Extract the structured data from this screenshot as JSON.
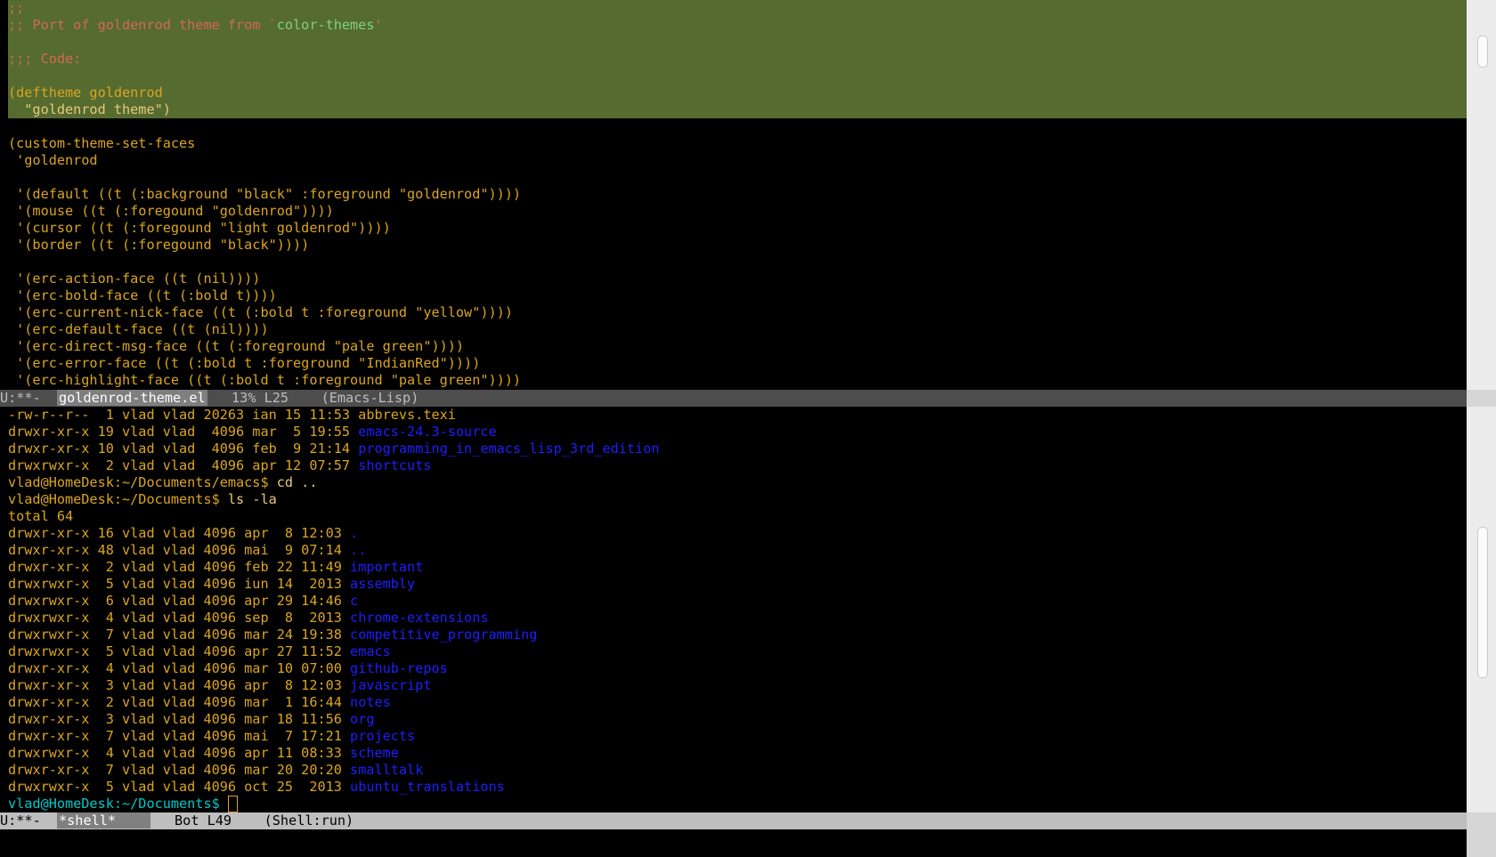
{
  "top_buffer": {
    "lines": [
      {
        "segments": [
          {
            "t": ";;",
            "c": "c-comment"
          }
        ],
        "region": true
      },
      {
        "segments": [
          {
            "t": ";; Port of goldenrod theme from `",
            "c": "c-comment"
          },
          {
            "t": "color-themes",
            "c": "c-doc"
          },
          {
            "t": "'",
            "c": "c-comment"
          }
        ],
        "region": true
      },
      {
        "segments": [],
        "region": true
      },
      {
        "segments": [
          {
            "t": ";;; Code:",
            "c": "c-comment"
          }
        ],
        "region": true
      },
      {
        "segments": [],
        "region": true
      },
      {
        "segments": [
          {
            "t": "(deftheme goldenrod",
            "c": "c-gold"
          }
        ],
        "region": true
      },
      {
        "segments": [
          {
            "t": "  \"goldenrod theme\")",
            "c": "c-str"
          }
        ],
        "region": true
      },
      {
        "segments": [],
        "region": false
      },
      {
        "segments": [
          {
            "t": "(custom-theme-set-faces",
            "c": "c-gold"
          }
        ],
        "region": false
      },
      {
        "segments": [
          {
            "t": " 'goldenrod",
            "c": "c-gold"
          }
        ],
        "region": false
      },
      {
        "segments": [],
        "region": false
      },
      {
        "segments": [
          {
            "t": " '(default ((t (:background \"black\" :foreground \"goldenrod\"))))",
            "c": "c-gold"
          }
        ],
        "region": false
      },
      {
        "segments": [
          {
            "t": " '(mouse ((t (:foregound \"goldenrod\"))))",
            "c": "c-gold"
          }
        ],
        "region": false
      },
      {
        "segments": [
          {
            "t": " '(cursor ((t (:foregound \"light goldenrod\"))))",
            "c": "c-gold"
          }
        ],
        "region": false
      },
      {
        "segments": [
          {
            "t": " '(border ((t (:foregound \"black\"))))",
            "c": "c-gold"
          }
        ],
        "region": false
      },
      {
        "segments": [],
        "region": false
      },
      {
        "segments": [
          {
            "t": " '(erc-action-face ((t (nil))))",
            "c": "c-gold"
          }
        ],
        "region": false
      },
      {
        "segments": [
          {
            "t": " '(erc-bold-face ((t (:bold t))))",
            "c": "c-gold"
          }
        ],
        "region": false
      },
      {
        "segments": [
          {
            "t": " '(erc-current-nick-face ((t (:bold t :foreground \"yellow\"))))",
            "c": "c-gold"
          }
        ],
        "region": false
      },
      {
        "segments": [
          {
            "t": " '(erc-default-face ((t (nil))))",
            "c": "c-gold"
          }
        ],
        "region": false
      },
      {
        "segments": [
          {
            "t": " '(erc-direct-msg-face ((t (:foreground \"pale green\"))))",
            "c": "c-gold"
          }
        ],
        "region": false
      },
      {
        "segments": [
          {
            "t": " '(erc-error-face ((t (:bold t :foreground \"IndianRed\"))))",
            "c": "c-gold"
          }
        ],
        "region": false
      },
      {
        "segments": [
          {
            "t": " '(erc-highlight-face ((t (:bold t :foreground \"pale green\"))))",
            "c": "c-gold"
          }
        ],
        "region": false
      }
    ]
  },
  "top_modeline": {
    "status": "U:**-  ",
    "buffer_name": "goldenrod-theme.el",
    "position": "   13% L25    ",
    "mode": "(Emacs-Lisp)"
  },
  "bottom_buffer": {
    "lines": [
      {
        "segments": [
          {
            "t": "-rw-r--r--  1 vlad vlad 20263 ian 15 11:53 abbrevs.texi",
            "c": "c-gold"
          }
        ]
      },
      {
        "segments": [
          {
            "t": "drwxr-xr-x 19 vlad vlad  4096 mar  5 19:55 ",
            "c": "c-gold"
          },
          {
            "t": "emacs-24.3-source",
            "c": "c-dir"
          }
        ]
      },
      {
        "segments": [
          {
            "t": "drwxr-xr-x 10 vlad vlad  4096 feb  9 21:14 ",
            "c": "c-gold"
          },
          {
            "t": "programming_in_emacs_lisp_3rd_edition",
            "c": "c-dir"
          }
        ]
      },
      {
        "segments": [
          {
            "t": "drwxrwxr-x  2 vlad vlad  4096 apr 12 07:57 ",
            "c": "c-gold"
          },
          {
            "t": "shortcuts",
            "c": "c-dir"
          }
        ]
      },
      {
        "segments": [
          {
            "t": "vlad@HomeDesk:~/Documents/emacs$ ",
            "c": "c-prompt"
          },
          {
            "t": "cd ..",
            "c": "c-str"
          }
        ]
      },
      {
        "segments": [
          {
            "t": "vlad@HomeDesk:~/Documents$ ",
            "c": "c-prompt"
          },
          {
            "t": "ls -la",
            "c": "c-str"
          }
        ]
      },
      {
        "segments": [
          {
            "t": "total 64",
            "c": "c-gold"
          }
        ]
      },
      {
        "segments": [
          {
            "t": "drwxr-xr-x 16 vlad vlad 4096 apr  8 12:03 ",
            "c": "c-gold"
          },
          {
            "t": ".",
            "c": "c-dir"
          }
        ]
      },
      {
        "segments": [
          {
            "t": "drwxr-xr-x 48 vlad vlad 4096 mai  9 07:14 ",
            "c": "c-gold"
          },
          {
            "t": "..",
            "c": "c-dir"
          }
        ]
      },
      {
        "segments": [
          {
            "t": "drwxr-xr-x  2 vlad vlad 4096 feb 22 11:49 ",
            "c": "c-gold"
          },
          {
            "t": "important",
            "c": "c-dir"
          }
        ]
      },
      {
        "segments": [
          {
            "t": "drwxrwxr-x  5 vlad vlad 4096 iun 14  2013 ",
            "c": "c-gold"
          },
          {
            "t": "assembly",
            "c": "c-dir"
          }
        ]
      },
      {
        "segments": [
          {
            "t": "drwxrwxr-x  6 vlad vlad 4096 apr 29 14:46 ",
            "c": "c-gold"
          },
          {
            "t": "c",
            "c": "c-dir"
          }
        ]
      },
      {
        "segments": [
          {
            "t": "drwxrwxr-x  4 vlad vlad 4096 sep  8  2013 ",
            "c": "c-gold"
          },
          {
            "t": "chrome-extensions",
            "c": "c-dir"
          }
        ]
      },
      {
        "segments": [
          {
            "t": "drwxrwxr-x  7 vlad vlad 4096 mar 24 19:38 ",
            "c": "c-gold"
          },
          {
            "t": "competitive_programming",
            "c": "c-dir"
          }
        ]
      },
      {
        "segments": [
          {
            "t": "drwxrwxr-x  5 vlad vlad 4096 apr 27 11:52 ",
            "c": "c-gold"
          },
          {
            "t": "emacs",
            "c": "c-dir"
          }
        ]
      },
      {
        "segments": [
          {
            "t": "drwxr-xr-x  4 vlad vlad 4096 mar 10 07:00 ",
            "c": "c-gold"
          },
          {
            "t": "github-repos",
            "c": "c-dir"
          }
        ]
      },
      {
        "segments": [
          {
            "t": "drwxr-xr-x  3 vlad vlad 4096 apr  8 12:03 ",
            "c": "c-gold"
          },
          {
            "t": "javascript",
            "c": "c-dir"
          }
        ]
      },
      {
        "segments": [
          {
            "t": "drwxr-xr-x  2 vlad vlad 4096 mar  1 16:44 ",
            "c": "c-gold"
          },
          {
            "t": "notes",
            "c": "c-dir"
          }
        ]
      },
      {
        "segments": [
          {
            "t": "drwxr-xr-x  3 vlad vlad 4096 mar 18 11:56 ",
            "c": "c-gold"
          },
          {
            "t": "org",
            "c": "c-dir"
          }
        ]
      },
      {
        "segments": [
          {
            "t": "drwxr-xr-x  7 vlad vlad 4096 mai  7 17:21 ",
            "c": "c-gold"
          },
          {
            "t": "projects",
            "c": "c-dir"
          }
        ]
      },
      {
        "segments": [
          {
            "t": "drwxrwxr-x  4 vlad vlad 4096 apr 11 08:33 ",
            "c": "c-gold"
          },
          {
            "t": "scheme",
            "c": "c-dir"
          }
        ]
      },
      {
        "segments": [
          {
            "t": "drwxr-xr-x  7 vlad vlad 4096 mar 20 20:20 ",
            "c": "c-gold"
          },
          {
            "t": "smalltalk",
            "c": "c-dir"
          }
        ]
      },
      {
        "segments": [
          {
            "t": "drwxrwxr-x  5 vlad vlad 4096 oct 25  2013 ",
            "c": "c-gold"
          },
          {
            "t": "ubuntu_translations",
            "c": "c-dir"
          }
        ]
      },
      {
        "segments": [
          {
            "t": "vlad@HomeDesk:~/Documents$ ",
            "c": "c-cyan"
          }
        ],
        "cursor": true
      }
    ]
  },
  "bottom_modeline": {
    "status": "U:**-  ",
    "buffer_name": "*shell*    ",
    "position": "   Bot L49    ",
    "mode": "(Shell:run)"
  },
  "colors": {
    "background": "#000000",
    "foreground": "#daa520",
    "region": "#556b2f",
    "comment": "#d26a52",
    "directory": "#1e1eff",
    "modeline_active": "#bebebe",
    "modeline_inactive": "#4d4d4d"
  }
}
